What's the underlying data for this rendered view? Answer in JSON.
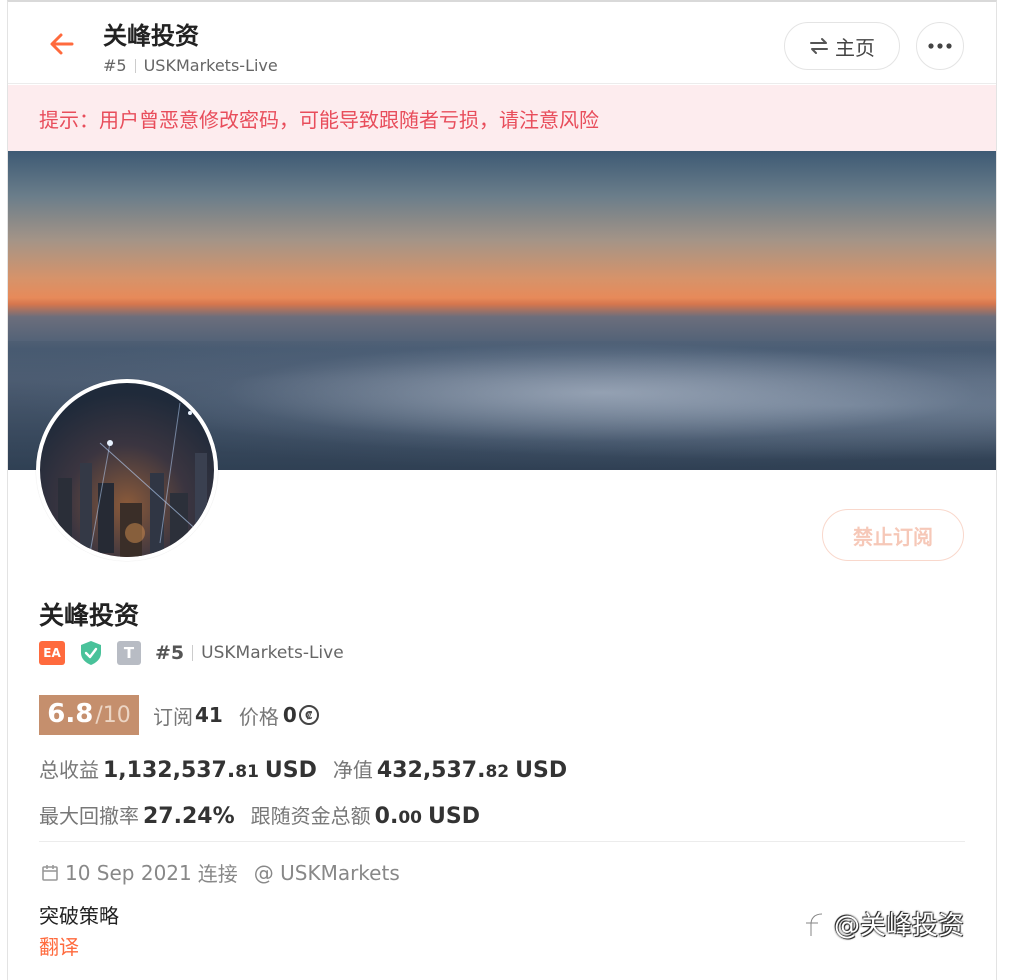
{
  "header": {
    "title": "关峰投资",
    "rank": "#5",
    "server": "USKMarkets-Live",
    "home_label": "主页"
  },
  "warning": "提示：用户曾恶意修改密码，可能导致跟随者亏损，请注意风险",
  "profile": {
    "ban_label": "禁止订阅",
    "name": "关峰投资",
    "badge_ea": "EA",
    "badge_t": "T",
    "rank": "#5",
    "server": "USKMarkets-Live",
    "score": "6.8",
    "score_max": "/10",
    "subscribe_label": "订阅",
    "subscribe_count": "41",
    "price_label": "价格",
    "price_value": "0",
    "total_profit_label": "总收益",
    "total_profit_int": "1,132,537.",
    "total_profit_dec": "81",
    "total_profit_unit": "USD",
    "equity_label": "净值",
    "equity_int": "432,537.",
    "equity_dec": "82",
    "equity_unit": "USD",
    "max_dd_label": "最大回撤率",
    "max_dd_value": "27.24%",
    "follow_funds_label": "跟随资金总额",
    "follow_funds_int": "0.",
    "follow_funds_dec": "00",
    "follow_funds_unit": "USD",
    "connected_date": "10 Sep 2021",
    "connected_label": "连接",
    "broker": "@ USKMarkets",
    "strategy": "突破策略",
    "translate_label": "翻译"
  },
  "watermark": "@关峰投资",
  "colors": {
    "accent": "#ff6a3d",
    "warning_bg": "#fdecee",
    "warning_text": "#e84d5b",
    "score_bg": "#c58f6d"
  }
}
